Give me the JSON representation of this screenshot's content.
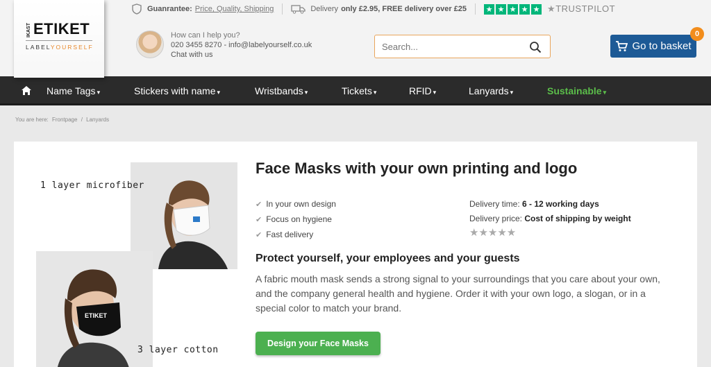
{
  "logo": {
    "top": "IKAST",
    "main": "ETIKET",
    "sub_a": "LABEL",
    "sub_b": "YOURSELF"
  },
  "topbar": {
    "guarantee_label": "Guanrantee:",
    "guarantee_links": "Price, Quality, Shipping",
    "delivery_prefix": "Delivery",
    "delivery_bold": "only £2.95, FREE delivery over £25",
    "trustpilot": "TRUSTPILOT"
  },
  "help": {
    "question": "How can I help you?",
    "contact": "020 3455 8270 - info@labelyourself.co.uk",
    "chat": "Chat with us"
  },
  "search": {
    "placeholder": "Search..."
  },
  "basket": {
    "label": "Go to basket",
    "count": "0"
  },
  "nav": {
    "items": [
      {
        "label": "Name Tags"
      },
      {
        "label": "Stickers with name"
      },
      {
        "label": "Wristbands"
      },
      {
        "label": "Tickets"
      },
      {
        "label": "RFID"
      },
      {
        "label": "Lanyards"
      },
      {
        "label": "Sustainable"
      }
    ]
  },
  "breadcrumb": {
    "prefix": "You are here:",
    "home": "Frontpage",
    "sep": "/",
    "current": "Lanyards"
  },
  "product": {
    "image_label_1": "1 layer microfiber",
    "image_label_2": "3 layer cotton",
    "title": "Face Masks with your own printing and logo",
    "features": [
      "In your own design",
      "Focus on hygiene",
      "Fast delivery"
    ],
    "delivery_time_label": "Delivery time:",
    "delivery_time": "6 - 12 working days",
    "delivery_price_label": "Delivery price:",
    "delivery_price": "Cost of shipping by weight",
    "rating_stars": "★★★★★",
    "subtitle": "Protect yourself, your employees and your guests",
    "description": "A fabric mouth mask sends a strong signal to your surroundings that you care about your own, and the company general health and hygiene. Order it with your own logo, a slogan, or in a special color to match your brand.",
    "cta": "Design your Face Masks"
  },
  "colors": {
    "accent": "#1d5a96",
    "cta": "#4cb050",
    "badge": "#f28d1c",
    "nav": "#2b2b2b",
    "sustainable": "#5bbd4a",
    "trustpilot": "#00b67a"
  }
}
